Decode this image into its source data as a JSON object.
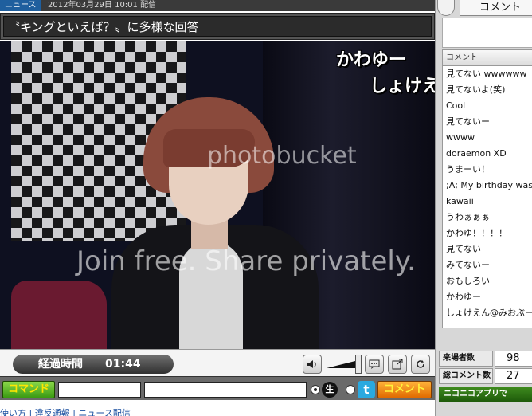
{
  "topbar": {
    "news_tag": "ニュース",
    "date": "2012年03月29日 10:01 配信"
  },
  "headline": "〝キングといえば？〟に多様な回答",
  "video": {
    "overlay_lines": [
      "かわゆー",
      "しょけえ"
    ],
    "watermark_logo": "photobucket",
    "watermark_tagline": "Join free. Share privately."
  },
  "controls": {
    "elapsed_label": "経過時間",
    "elapsed_time": "01:44",
    "icons": [
      "speaker-icon",
      "comment-list-icon",
      "popout-icon",
      "reload-icon"
    ]
  },
  "inputbar": {
    "command_label": "コマンド",
    "live_label": "生",
    "twitter_label": "t",
    "comment_label": "コメント",
    "comment_value": ""
  },
  "bottom_links": "使い方 | 違反通報 | ニュース配信",
  "panel": {
    "tab_label": "コメント",
    "list_header": "コメント",
    "comments": [
      "見てない wwwwww",
      "見てないよ(笑)",
      "Cool",
      "見てないー",
      "wwww",
      "doraemon XD",
      "うまーい！",
      ";A; My birthday was t",
      "kawaii",
      "うわぁぁぁ",
      "かわゆ！！！！",
      "見てない",
      "みてないー",
      "おもしろい",
      "かわゆー",
      "しょけえん@みおぶー"
    ],
    "stats": [
      {
        "label": "来場者数",
        "value": "98"
      },
      {
        "label": "総コメント数",
        "value": "27"
      }
    ],
    "app_button": "ニコニコアプリで"
  }
}
